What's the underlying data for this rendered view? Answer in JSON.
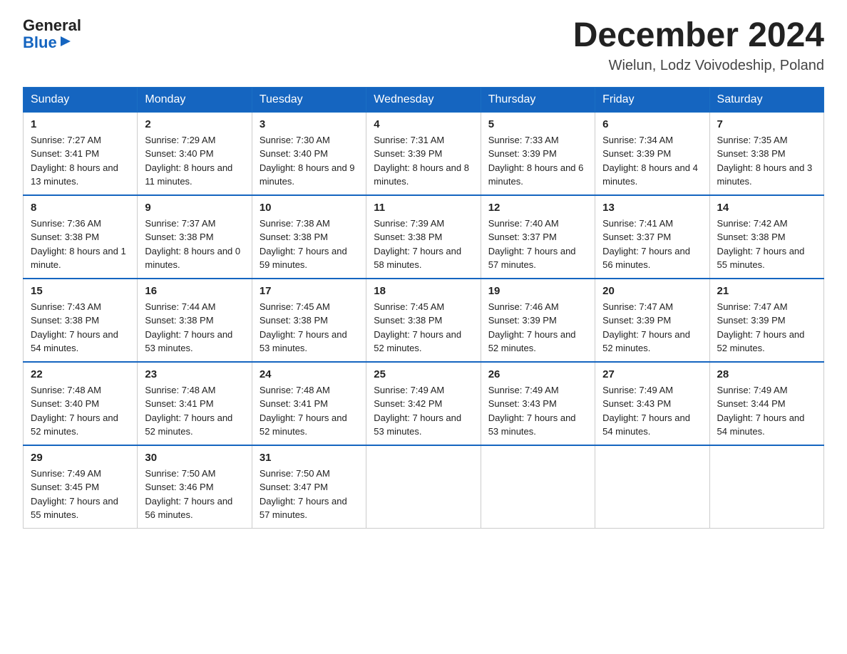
{
  "logo": {
    "general": "General",
    "blue": "Blue",
    "arrow": "▶"
  },
  "title": "December 2024",
  "subtitle": "Wielun, Lodz Voivodeship, Poland",
  "days_of_week": [
    "Sunday",
    "Monday",
    "Tuesday",
    "Wednesday",
    "Thursday",
    "Friday",
    "Saturday"
  ],
  "weeks": [
    [
      {
        "day": "1",
        "sunrise": "7:27 AM",
        "sunset": "3:41 PM",
        "daylight": "8 hours and 13 minutes."
      },
      {
        "day": "2",
        "sunrise": "7:29 AM",
        "sunset": "3:40 PM",
        "daylight": "8 hours and 11 minutes."
      },
      {
        "day": "3",
        "sunrise": "7:30 AM",
        "sunset": "3:40 PM",
        "daylight": "8 hours and 9 minutes."
      },
      {
        "day": "4",
        "sunrise": "7:31 AM",
        "sunset": "3:39 PM",
        "daylight": "8 hours and 8 minutes."
      },
      {
        "day": "5",
        "sunrise": "7:33 AM",
        "sunset": "3:39 PM",
        "daylight": "8 hours and 6 minutes."
      },
      {
        "day": "6",
        "sunrise": "7:34 AM",
        "sunset": "3:39 PM",
        "daylight": "8 hours and 4 minutes."
      },
      {
        "day": "7",
        "sunrise": "7:35 AM",
        "sunset": "3:38 PM",
        "daylight": "8 hours and 3 minutes."
      }
    ],
    [
      {
        "day": "8",
        "sunrise": "7:36 AM",
        "sunset": "3:38 PM",
        "daylight": "8 hours and 1 minute."
      },
      {
        "day": "9",
        "sunrise": "7:37 AM",
        "sunset": "3:38 PM",
        "daylight": "8 hours and 0 minutes."
      },
      {
        "day": "10",
        "sunrise": "7:38 AM",
        "sunset": "3:38 PM",
        "daylight": "7 hours and 59 minutes."
      },
      {
        "day": "11",
        "sunrise": "7:39 AM",
        "sunset": "3:38 PM",
        "daylight": "7 hours and 58 minutes."
      },
      {
        "day": "12",
        "sunrise": "7:40 AM",
        "sunset": "3:37 PM",
        "daylight": "7 hours and 57 minutes."
      },
      {
        "day": "13",
        "sunrise": "7:41 AM",
        "sunset": "3:37 PM",
        "daylight": "7 hours and 56 minutes."
      },
      {
        "day": "14",
        "sunrise": "7:42 AM",
        "sunset": "3:38 PM",
        "daylight": "7 hours and 55 minutes."
      }
    ],
    [
      {
        "day": "15",
        "sunrise": "7:43 AM",
        "sunset": "3:38 PM",
        "daylight": "7 hours and 54 minutes."
      },
      {
        "day": "16",
        "sunrise": "7:44 AM",
        "sunset": "3:38 PM",
        "daylight": "7 hours and 53 minutes."
      },
      {
        "day": "17",
        "sunrise": "7:45 AM",
        "sunset": "3:38 PM",
        "daylight": "7 hours and 53 minutes."
      },
      {
        "day": "18",
        "sunrise": "7:45 AM",
        "sunset": "3:38 PM",
        "daylight": "7 hours and 52 minutes."
      },
      {
        "day": "19",
        "sunrise": "7:46 AM",
        "sunset": "3:39 PM",
        "daylight": "7 hours and 52 minutes."
      },
      {
        "day": "20",
        "sunrise": "7:47 AM",
        "sunset": "3:39 PM",
        "daylight": "7 hours and 52 minutes."
      },
      {
        "day": "21",
        "sunrise": "7:47 AM",
        "sunset": "3:39 PM",
        "daylight": "7 hours and 52 minutes."
      }
    ],
    [
      {
        "day": "22",
        "sunrise": "7:48 AM",
        "sunset": "3:40 PM",
        "daylight": "7 hours and 52 minutes."
      },
      {
        "day": "23",
        "sunrise": "7:48 AM",
        "sunset": "3:41 PM",
        "daylight": "7 hours and 52 minutes."
      },
      {
        "day": "24",
        "sunrise": "7:48 AM",
        "sunset": "3:41 PM",
        "daylight": "7 hours and 52 minutes."
      },
      {
        "day": "25",
        "sunrise": "7:49 AM",
        "sunset": "3:42 PM",
        "daylight": "7 hours and 53 minutes."
      },
      {
        "day": "26",
        "sunrise": "7:49 AM",
        "sunset": "3:43 PM",
        "daylight": "7 hours and 53 minutes."
      },
      {
        "day": "27",
        "sunrise": "7:49 AM",
        "sunset": "3:43 PM",
        "daylight": "7 hours and 54 minutes."
      },
      {
        "day": "28",
        "sunrise": "7:49 AM",
        "sunset": "3:44 PM",
        "daylight": "7 hours and 54 minutes."
      }
    ],
    [
      {
        "day": "29",
        "sunrise": "7:49 AM",
        "sunset": "3:45 PM",
        "daylight": "7 hours and 55 minutes."
      },
      {
        "day": "30",
        "sunrise": "7:50 AM",
        "sunset": "3:46 PM",
        "daylight": "7 hours and 56 minutes."
      },
      {
        "day": "31",
        "sunrise": "7:50 AM",
        "sunset": "3:47 PM",
        "daylight": "7 hours and 57 minutes."
      },
      null,
      null,
      null,
      null
    ]
  ]
}
